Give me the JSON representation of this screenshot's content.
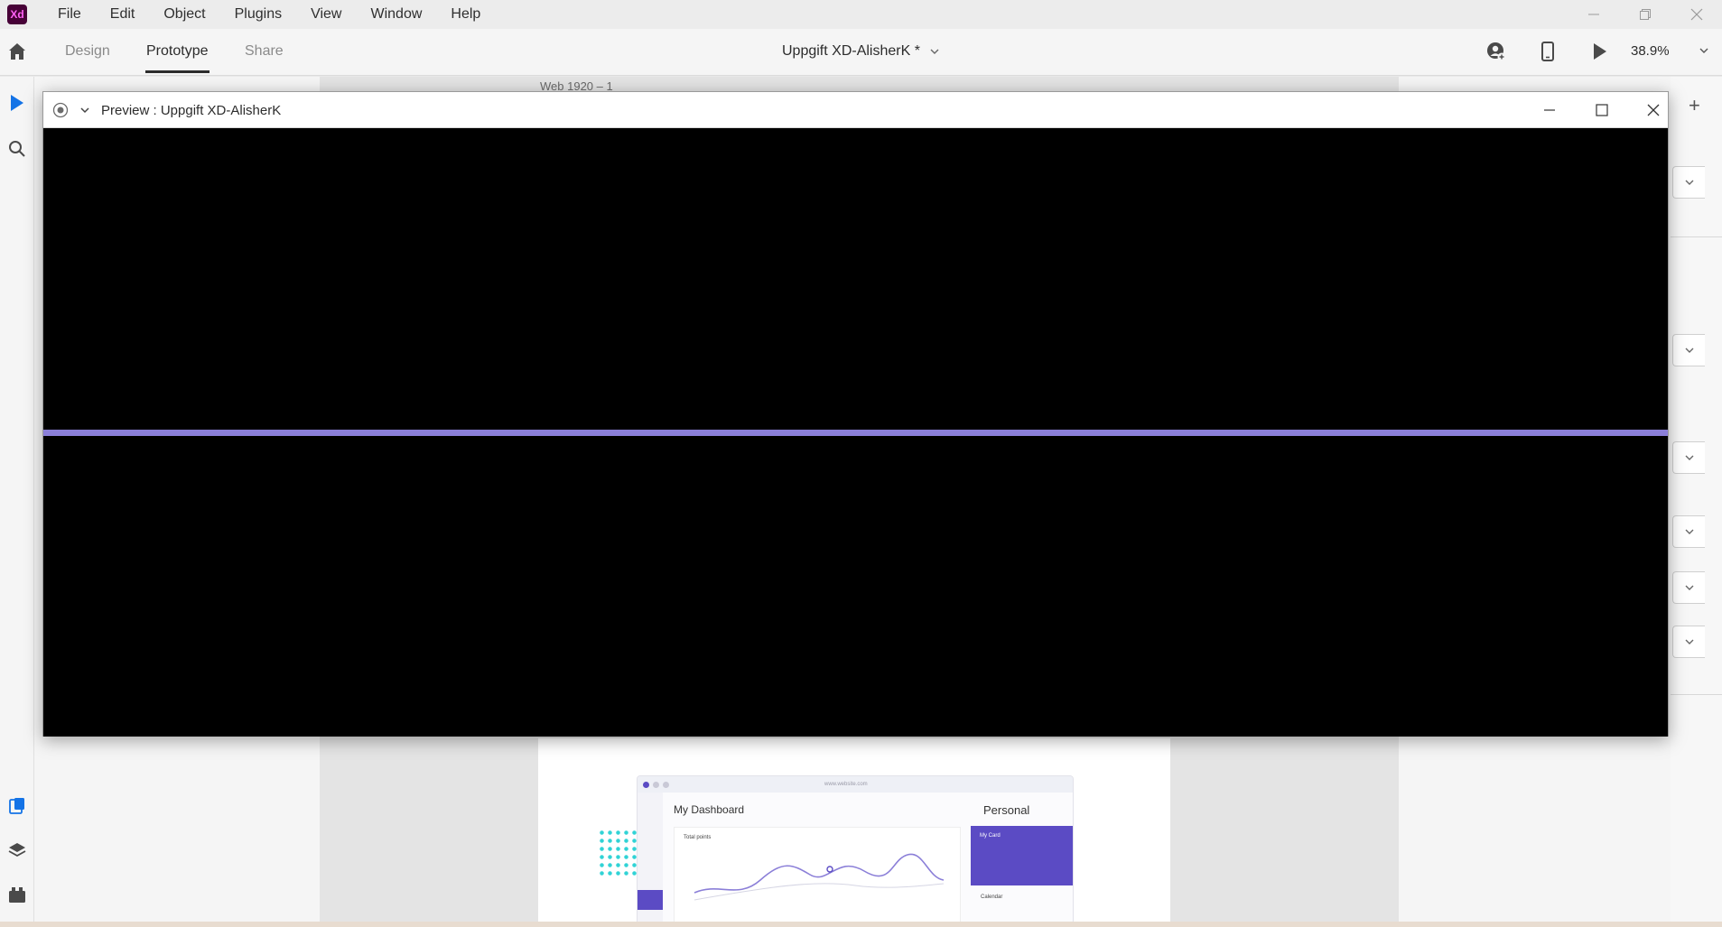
{
  "app": {
    "logo_text": "Xd",
    "menu": [
      "File",
      "Edit",
      "Object",
      "Plugins",
      "View",
      "Window",
      "Help"
    ]
  },
  "toolbar": {
    "tabs": [
      {
        "label": "Design"
      },
      {
        "label": "Prototype"
      },
      {
        "label": "Share"
      }
    ],
    "doc_title": "Uppgift XD-AlisherK *",
    "zoom": "38.9%"
  },
  "canvas": {
    "artboard_label": "Web 1920 – 1"
  },
  "dashboard_thumb": {
    "url": "www.website.com",
    "title": "My Dashboard",
    "personal": "Personal",
    "my_card": "My Card",
    "total_points": "Total points",
    "calendar": "Calendar"
  },
  "preview": {
    "title": "Preview : Uppgift XD-AlisherK",
    "accent_line_color": "#8b7fd8"
  },
  "colors": {
    "brand": "#470137",
    "brand_accent": "#ff61f6",
    "select_tool": "#1473e6",
    "dashboard_accent": "#5b4bc4",
    "dots": "#31d3d6"
  }
}
